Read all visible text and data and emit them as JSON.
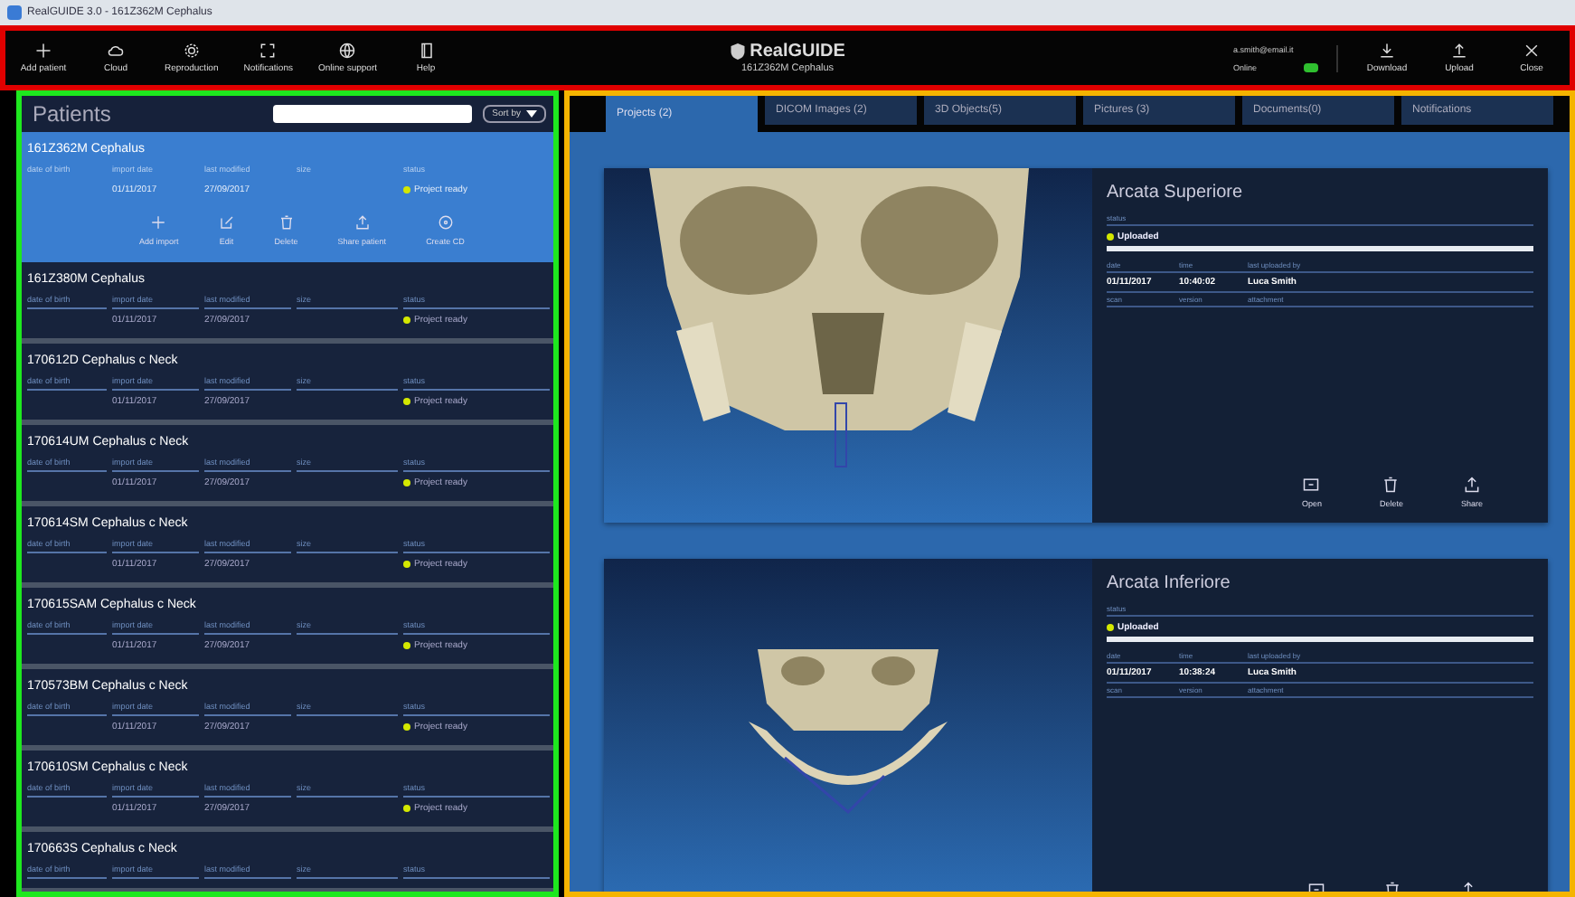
{
  "window": {
    "title": "RealGUIDE 3.0 - 161Z362M Cephalus"
  },
  "toolbar": {
    "left": [
      {
        "kind": "plus",
        "label": "Add patient"
      },
      {
        "kind": "cloud",
        "label": "Cloud"
      },
      {
        "kind": "gear",
        "label": "Reproduction"
      },
      {
        "kind": "expand",
        "label": "Notifications"
      },
      {
        "kind": "globe",
        "label": "Online support"
      },
      {
        "kind": "book",
        "label": "Help"
      }
    ],
    "logo": "RealGUIDE",
    "subtitle": "161Z362M Cephalus",
    "user": "a.smith@email.it",
    "connection": "Online",
    "online": true,
    "right": [
      {
        "kind": "download",
        "label": "Download"
      },
      {
        "kind": "upload",
        "label": "Upload"
      },
      {
        "kind": "close",
        "label": "Close"
      }
    ]
  },
  "patients": {
    "title": "Patients",
    "sort": "Sort by",
    "actions": [
      {
        "kind": "plus",
        "label": "Add import"
      },
      {
        "kind": "edit",
        "label": "Edit"
      },
      {
        "kind": "trash",
        "label": "Delete"
      },
      {
        "kind": "share",
        "label": "Share patient"
      },
      {
        "kind": "disc",
        "label": "Create CD"
      }
    ],
    "rows": [
      {
        "name": "161Z362M Cephalus",
        "selected": true,
        "labels": [
          "date of birth",
          "import date",
          "last modified",
          "size",
          "status"
        ],
        "import_date": "01/11/2017",
        "last_modified": "27/09/2017",
        "status": "Project ready"
      },
      {
        "name": "161Z380M Cephalus",
        "selected": false,
        "labels": [
          "date of birth",
          "import date",
          "last modified",
          "size",
          "status"
        ],
        "import_date": "01/11/2017",
        "last_modified": "27/09/2017",
        "status": "Project ready"
      },
      {
        "name": "170612D Cephalus c Neck",
        "selected": false,
        "labels": [
          "date of birth",
          "import date",
          "last modified",
          "size",
          "status"
        ],
        "import_date": "01/11/2017",
        "last_modified": "27/09/2017",
        "status": "Project ready"
      },
      {
        "name": "170614UM Cephalus c Neck",
        "selected": false,
        "labels": [
          "date of birth",
          "import date",
          "last modified",
          "size",
          "status"
        ],
        "import_date": "01/11/2017",
        "last_modified": "27/09/2017",
        "status": "Project ready"
      },
      {
        "name": "170614SM Cephalus c Neck",
        "selected": false,
        "labels": [
          "date of birth",
          "import date",
          "last modified",
          "size",
          "status"
        ],
        "import_date": "01/11/2017",
        "last_modified": "27/09/2017",
        "status": "Project ready"
      },
      {
        "name": "170615SAM Cephalus c Neck",
        "selected": false,
        "labels": [
          "date of birth",
          "import date",
          "last modified",
          "size",
          "status"
        ],
        "import_date": "01/11/2017",
        "last_modified": "27/09/2017",
        "status": "Project ready"
      },
      {
        "name": "170573BM Cephalus c Neck",
        "selected": false,
        "labels": [
          "date of birth",
          "import date",
          "last modified",
          "size",
          "status"
        ],
        "import_date": "01/11/2017",
        "last_modified": "27/09/2017",
        "status": "Project ready"
      },
      {
        "name": "170610SM Cephalus c Neck",
        "selected": false,
        "labels": [
          "date of birth",
          "import date",
          "last modified",
          "size",
          "status"
        ],
        "import_date": "01/11/2017",
        "last_modified": "27/09/2017",
        "status": "Project ready"
      },
      {
        "name": "170663S Cephalus c Neck",
        "selected": false,
        "labels": [
          "date of birth",
          "import date",
          "last modified",
          "size",
          "status"
        ]
      }
    ]
  },
  "tabs": [
    {
      "label": "Projects (2)",
      "selected": true
    },
    {
      "label": "DICOM Images (2)",
      "selected": false
    },
    {
      "label": "3D Objects(5)",
      "selected": false
    },
    {
      "label": "Pictures (3)",
      "selected": false
    },
    {
      "label": "Documents(0)",
      "selected": false
    },
    {
      "label": "Notifications",
      "selected": false
    }
  ],
  "projects": [
    {
      "title": "Arcata Superiore",
      "status_label": "status",
      "status": "Uploaded",
      "level": 1,
      "labels": [
        "date",
        "time",
        "last uploaded by"
      ],
      "values": [
        "01/11/2017",
        "10:40:02",
        "Luca Smith"
      ],
      "labels2": [
        "scan",
        "version",
        "attachment"
      ],
      "buttons": [
        {
          "kind": "open",
          "label": "Open"
        },
        {
          "kind": "trash",
          "label": "Delete"
        },
        {
          "kind": "share",
          "label": "Share"
        }
      ]
    },
    {
      "title": "Arcata Inferiore",
      "status_label": "status",
      "status": "Uploaded",
      "level": 1,
      "labels": [
        "date",
        "time",
        "last uploaded by"
      ],
      "values": [
        "01/11/2017",
        "10:38:24",
        "Luca Smith"
      ],
      "labels2": [
        "scan",
        "version",
        "attachment"
      ],
      "buttons": [
        {
          "kind": "open"
        },
        {
          "kind": "trash"
        },
        {
          "kind": "share"
        }
      ]
    }
  ]
}
